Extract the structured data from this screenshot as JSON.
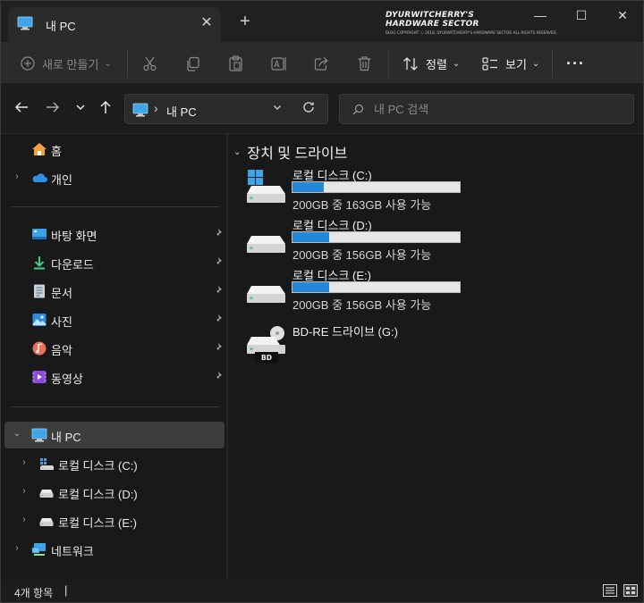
{
  "tab": {
    "title": "내 PC",
    "close": "✕",
    "new_tab": "+"
  },
  "watermark": {
    "title": "DYURWITCHERRY'S HARDWARE SECTOR",
    "subtitle": "BLOG COPYRIGHT ⓒ 2018, DYURWITCHERRY'S HARDWARE SECTOR ALL RIGHTS RESERVED."
  },
  "window_controls": {
    "minimize": "—",
    "maximize": "☐",
    "close": "✕"
  },
  "toolbar": {
    "new_label": "새로 만들기",
    "sort_label": "정렬",
    "view_label": "보기",
    "more": "···"
  },
  "address": {
    "path": "내 PC",
    "separator": "›"
  },
  "search": {
    "placeholder": "내 PC 검색"
  },
  "sidebar": {
    "home": "홈",
    "personal": "개인",
    "quick": [
      {
        "label": "바탕 화면"
      },
      {
        "label": "다운로드"
      },
      {
        "label": "문서"
      },
      {
        "label": "사진"
      },
      {
        "label": "음악"
      },
      {
        "label": "동영상"
      }
    ],
    "this_pc": "내 PC",
    "drives": [
      {
        "label": "로컬 디스크 (C:)"
      },
      {
        "label": "로컬 디스크 (D:)"
      },
      {
        "label": "로컬 디스크 (E:)"
      }
    ],
    "network": "네트워크"
  },
  "content": {
    "group_title": "장치 및 드라이브",
    "drives": [
      {
        "name": "로컬 디스크 (C:)",
        "space": "200GB 중 163GB 사용 가능",
        "used_fraction": 0.185
      },
      {
        "name": "로컬 디스크 (D:)",
        "space": "200GB 중 156GB 사용 가능",
        "used_fraction": 0.22
      },
      {
        "name": "로컬 디스크 (E:)",
        "space": "200GB 중 156GB 사용 가능",
        "used_fraction": 0.22
      },
      {
        "name": "BD-RE 드라이브 (G:)",
        "badge": "BD"
      }
    ]
  },
  "status": {
    "item_count": "4개 항목",
    "caret": "|"
  },
  "colors": {
    "accent": "#2488d8",
    "selected_bg": "#3d3d3d",
    "window_bg": "#191919"
  }
}
